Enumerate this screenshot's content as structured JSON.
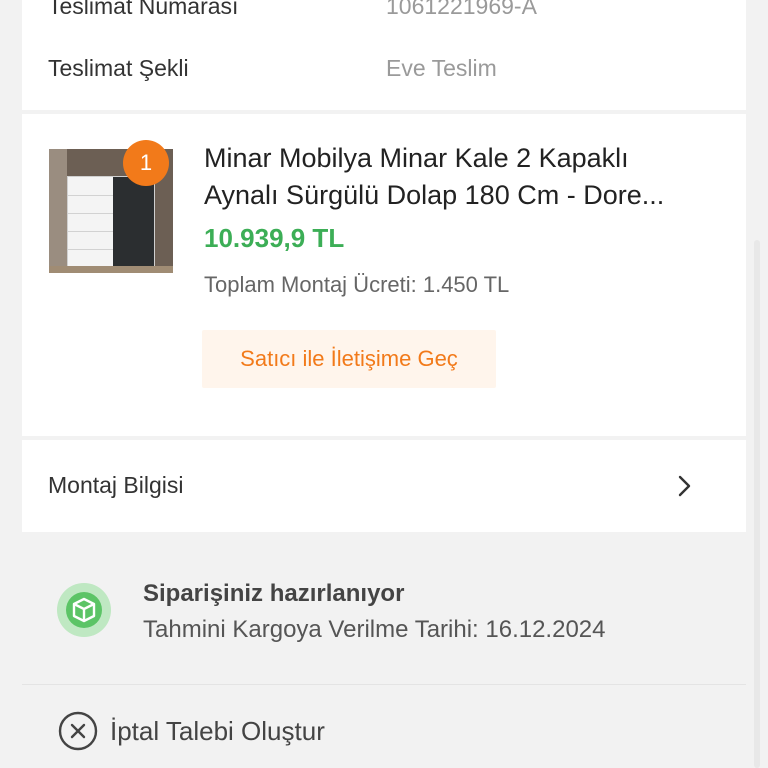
{
  "delivery": {
    "number_label": "Teslimat Numarası",
    "number_value": "1061221969-A",
    "method_label": "Teslimat Şekli",
    "method_value": "Eve Teslim"
  },
  "product": {
    "quantity_badge": "1",
    "title_line1": "Minar Mobilya Minar Kale 2 Kapaklı",
    "title_line2": "Aynalı Sürgülü Dolap 180 Cm - Dore...",
    "price": "10.939,9 TL",
    "mounting_fee": "Toplam Montaj Ücreti: 1.450 TL",
    "contact_seller_label": "Satıcı ile İletişime Geç"
  },
  "mounting_info": {
    "label": "Montaj Bilgisi",
    "icon": "chevron-right-icon"
  },
  "order_status": {
    "icon": "package-check-icon",
    "title": "Siparişiniz hazırlanıyor",
    "estimate": "Tahmini Kargoya Verilme Tarihi: 16.12.2024"
  },
  "cancel": {
    "icon": "close-circle-icon",
    "label": "İptal Talebi Oluştur"
  },
  "colors": {
    "brand_orange": "#f27a1a",
    "price_green": "#3cae56",
    "status_green": "#5cc466"
  }
}
